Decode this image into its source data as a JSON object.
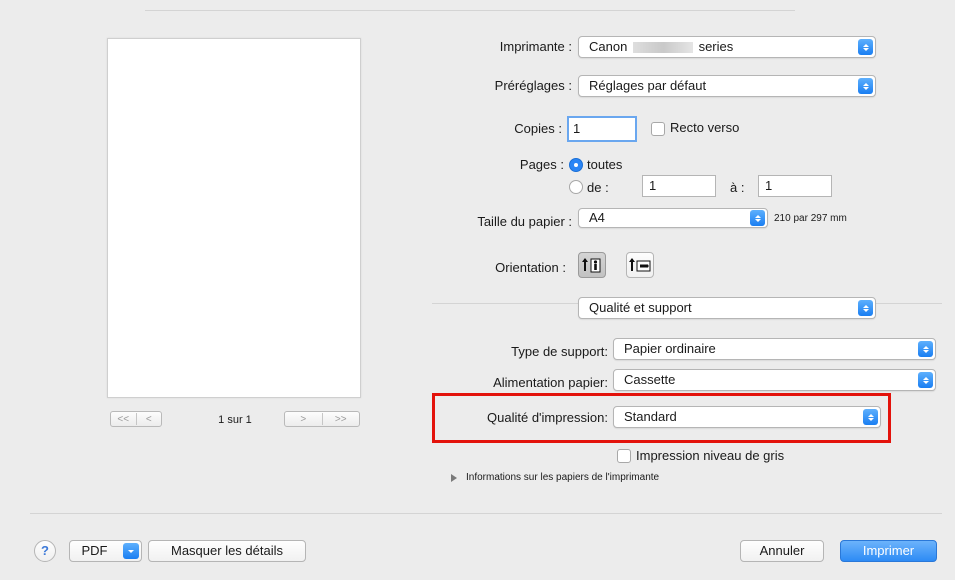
{
  "printer": {
    "label": "Imprimante :",
    "value_prefix": "Canon",
    "value_suffix": "series"
  },
  "presets": {
    "label": "Préréglages :",
    "value": "Réglages par défaut"
  },
  "copies": {
    "label": "Copies :",
    "value": "1",
    "duplex_label": "Recto verso"
  },
  "pages": {
    "label": "Pages :",
    "all_label": "toutes",
    "from_label": "de :",
    "from_value": "1",
    "to_label": "à :",
    "to_value": "1"
  },
  "paper_size": {
    "label": "Taille du papier :",
    "value": "A4",
    "dimensions": "210 par 297 mm"
  },
  "orientation": {
    "label": "Orientation :"
  },
  "section_popup": {
    "value": "Qualité et support"
  },
  "media_type": {
    "label": "Type de support:",
    "value": "Papier ordinaire"
  },
  "paper_source": {
    "label": "Alimentation papier:",
    "value": "Cassette"
  },
  "print_quality": {
    "label": "Qualité d'impression:",
    "value": "Standard"
  },
  "grayscale": {
    "label": "Impression niveau de gris"
  },
  "info": {
    "label": "Informations sur les papiers de l'imprimante"
  },
  "preview": {
    "page_count": "1 sur 1",
    "first": "<<",
    "prev": "<",
    "next": ">",
    "last": ">>"
  },
  "footer": {
    "help": "?",
    "pdf": "PDF",
    "hide_details": "Masquer les détails",
    "cancel": "Annuler",
    "print": "Imprimer"
  },
  "colors": {
    "accent": "#2d8bf5",
    "highlight": "#e3120b",
    "background": "#ececec"
  }
}
